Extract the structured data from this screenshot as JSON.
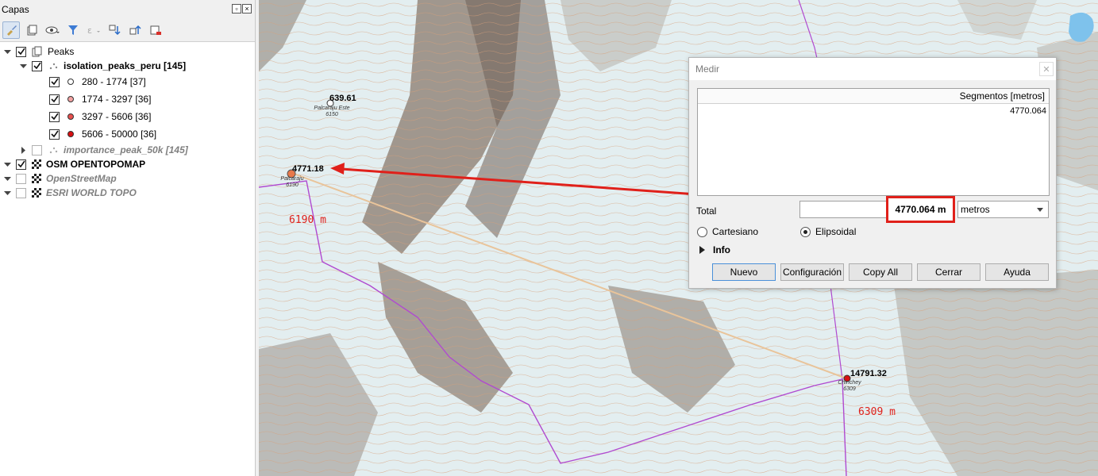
{
  "panel": {
    "title": "Capas"
  },
  "layers": {
    "peaks_group": "Peaks",
    "isolation_layer": "isolation_peaks_peru [145]",
    "classes": [
      {
        "label": "280 - 1774 [37]",
        "color": "#ffffff"
      },
      {
        "label": "1774 - 3297 [36]",
        "color": "#f4a3a3"
      },
      {
        "label": "3297 - 5606 [36]",
        "color": "#e8504e"
      },
      {
        "label": "5606 - 50000 [36]",
        "color": "#d90f12"
      }
    ],
    "importance_layer": "importance_peak_50k [145]",
    "osm_opentopomap": "OSM OPENTOPOMAP",
    "openstreetmap": "OpenStreetMap",
    "esri_world_topo": "ESRI WORLD TOPO"
  },
  "map": {
    "peaks": [
      {
        "value": "639.61",
        "name": "Palcaraju Este",
        "elev": "6150"
      },
      {
        "value": "4771.18",
        "name": "Palcaraju",
        "elev": "6190"
      },
      {
        "value": "14791.32",
        "name": "Chinchey",
        "elev": "6309"
      }
    ],
    "elev_labels": [
      "6190 m",
      "6309 m"
    ]
  },
  "dialog": {
    "title": "Medir",
    "close": "✕",
    "segments_header": "Segmentos [metros]",
    "segment_value": "4770.064",
    "total_label": "Total",
    "total_value": "4770.064 m",
    "units": "metros",
    "radio_cartesian": "Cartesiano",
    "radio_ellipsoidal": "Elipsoidal",
    "info": "Info",
    "btn_new": "Nuevo",
    "btn_config": "Configuración",
    "btn_copy": "Copy All",
    "btn_close": "Cerrar",
    "btn_help": "Ayuda"
  },
  "colors": {
    "annotation_red": "#e0201a",
    "measure_line": "#e9c49a",
    "boundary": "#b04ad0"
  }
}
